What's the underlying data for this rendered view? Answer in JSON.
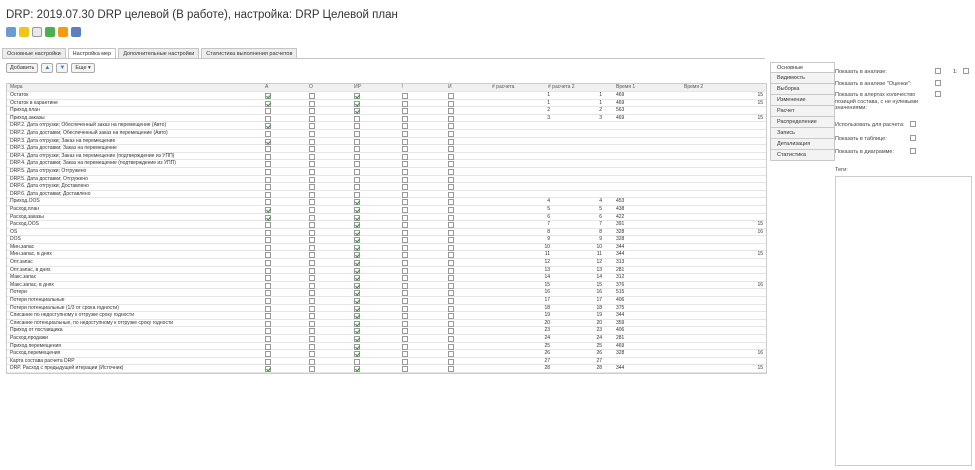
{
  "title": "DRP: 2019.07.30 DRP целевой (В работе), настройка: DRP Целевой план",
  "toolbar": {
    "icons": [
      "view-icon",
      "lock-icon",
      "copy-icon",
      "add-icon",
      "edit-icon",
      "save-icon"
    ]
  },
  "tabs": [
    "Основные настройки",
    "Настройка мер",
    "Дополнительные настройки",
    "Статистика выполнения расчетов"
  ],
  "active_tab": 1,
  "buttons": {
    "add": "Добавить",
    "more": "Еще ▾"
  },
  "columns": {
    "measure": "Мера",
    "a": "А",
    "o": "О",
    "ir": "ИР",
    "excl": "!",
    "i": "И",
    "calc": "# расчета",
    "calc2": "# расчета 2",
    "time1": "Время 1",
    "time2": "Время 2"
  },
  "rows": [
    {
      "name": "Остаток",
      "a": true,
      "o": false,
      "ir": true,
      "ex": false,
      "i": false,
      "calc": "1",
      "calc2": "1",
      "t1": "469",
      "t2": "15"
    },
    {
      "name": "Остаток в карантине",
      "a": true,
      "o": false,
      "ir": true,
      "ex": false,
      "i": false,
      "calc": "1",
      "calc2": "1",
      "t1": "469",
      "t2": "15"
    },
    {
      "name": "Приход.план",
      "a": false,
      "o": false,
      "ir": true,
      "ex": false,
      "i": false,
      "calc": "2",
      "calc2": "2",
      "t1": "563",
      "t2": ""
    },
    {
      "name": "Приход.заказы",
      "a": false,
      "o": false,
      "ir": false,
      "ex": false,
      "i": false,
      "calc": "3",
      "calc2": "3",
      "t1": "469",
      "t2": "15"
    },
    {
      "name": "DRP.2. Дата отгрузки; Обеспеченный заказ на перемещение (Авто)",
      "a": true,
      "o": false,
      "ir": false,
      "ex": false,
      "i": false,
      "calc": "",
      "calc2": "",
      "t1": "",
      "t2": ""
    },
    {
      "name": "DRP.2. Дата доставки; Обеспеченный заказ на перемещение (Авто)",
      "a": false,
      "o": false,
      "ir": false,
      "ex": false,
      "i": false,
      "calc": "",
      "calc2": "",
      "t1": "",
      "t2": ""
    },
    {
      "name": "DRP.3. Дата отгрузки; Заказ на перемещение",
      "a": true,
      "o": false,
      "ir": false,
      "ex": false,
      "i": false,
      "calc": "",
      "calc2": "",
      "t1": "",
      "t2": ""
    },
    {
      "name": "DRP.3. Дата доставки; Заказ на перемещение",
      "a": false,
      "o": false,
      "ir": false,
      "ex": false,
      "i": false,
      "calc": "",
      "calc2": "",
      "t1": "",
      "t2": ""
    },
    {
      "name": "DRP.4. Дата отгрузки; Заказ на перемещение (подтверждение из УПП)",
      "a": false,
      "o": false,
      "ir": false,
      "ex": false,
      "i": false,
      "calc": "",
      "calc2": "",
      "t1": "",
      "t2": ""
    },
    {
      "name": "DRP.4. Дата доставки; Заказ на перемещение (подтверждение из УПП)",
      "a": false,
      "o": false,
      "ir": false,
      "ex": false,
      "i": false,
      "calc": "",
      "calc2": "",
      "t1": "",
      "t2": ""
    },
    {
      "name": "DRP.5. Дата отгрузки; Отгружено",
      "a": false,
      "o": false,
      "ir": false,
      "ex": false,
      "i": false,
      "calc": "",
      "calc2": "",
      "t1": "",
      "t2": ""
    },
    {
      "name": "DRP.5. Дата доставки; Отгружено",
      "a": false,
      "o": false,
      "ir": false,
      "ex": false,
      "i": false,
      "calc": "",
      "calc2": "",
      "t1": "",
      "t2": ""
    },
    {
      "name": "DRP.6. Дата отгрузки; Доставлено",
      "a": false,
      "o": false,
      "ir": false,
      "ex": false,
      "i": false,
      "calc": "",
      "calc2": "",
      "t1": "",
      "t2": ""
    },
    {
      "name": "DRP.6. Дата доставки; Доставлено",
      "a": false,
      "o": false,
      "ir": false,
      "ex": false,
      "i": false,
      "calc": "",
      "calc2": "",
      "t1": "",
      "t2": ""
    },
    {
      "name": "Приход.OOS",
      "a": false,
      "o": false,
      "ir": true,
      "ex": false,
      "i": false,
      "calc": "4",
      "calc2": "4",
      "t1": "453",
      "t2": ""
    },
    {
      "name": "Расход.план",
      "a": true,
      "o": false,
      "ir": true,
      "ex": false,
      "i": false,
      "calc": "5",
      "calc2": "5",
      "t1": "438",
      "t2": ""
    },
    {
      "name": "Расход.заказы",
      "a": true,
      "o": false,
      "ir": true,
      "ex": false,
      "i": false,
      "calc": "6",
      "calc2": "6",
      "t1": "422",
      "t2": ""
    },
    {
      "name": "Расход.OOS",
      "a": false,
      "o": false,
      "ir": true,
      "ex": false,
      "i": false,
      "calc": "7",
      "calc2": "7",
      "t1": "391",
      "t2": "15"
    },
    {
      "name": "OS",
      "a": false,
      "o": false,
      "ir": true,
      "ex": false,
      "i": false,
      "calc": "8",
      "calc2": "8",
      "t1": "328",
      "t2": "16"
    },
    {
      "name": "DOS",
      "a": false,
      "o": false,
      "ir": true,
      "ex": false,
      "i": false,
      "calc": "9",
      "calc2": "9",
      "t1": "328",
      "t2": ""
    },
    {
      "name": "Мин.запас",
      "a": false,
      "o": false,
      "ir": true,
      "ex": false,
      "i": false,
      "calc": "10",
      "calc2": "10",
      "t1": "344",
      "t2": ""
    },
    {
      "name": "Мин.запас, в днях",
      "a": false,
      "o": false,
      "ir": true,
      "ex": false,
      "i": false,
      "calc": "11",
      "calc2": "11",
      "t1": "344",
      "t2": "15"
    },
    {
      "name": "Опт.запас",
      "a": false,
      "o": false,
      "ir": true,
      "ex": false,
      "i": false,
      "calc": "12",
      "calc2": "12",
      "t1": "313",
      "t2": ""
    },
    {
      "name": "Опт.запас, в днях",
      "a": false,
      "o": false,
      "ir": true,
      "ex": false,
      "i": false,
      "calc": "13",
      "calc2": "13",
      "t1": "281",
      "t2": ""
    },
    {
      "name": "Макс.запас",
      "a": false,
      "o": false,
      "ir": true,
      "ex": false,
      "i": false,
      "calc": "14",
      "calc2": "14",
      "t1": "312",
      "t2": ""
    },
    {
      "name": "Макс.запас, в днях",
      "a": false,
      "o": false,
      "ir": true,
      "ex": false,
      "i": false,
      "calc": "15",
      "calc2": "15",
      "t1": "376",
      "t2": "16"
    },
    {
      "name": "Потери",
      "a": false,
      "o": false,
      "ir": true,
      "ex": false,
      "i": false,
      "calc": "16",
      "calc2": "16",
      "t1": "515",
      "t2": ""
    },
    {
      "name": "Потери потенциальные",
      "a": false,
      "o": false,
      "ir": true,
      "ex": false,
      "i": false,
      "calc": "17",
      "calc2": "17",
      "t1": "406",
      "t2": ""
    },
    {
      "name": "Потери потенциальные (1/3 от срока годности)",
      "a": false,
      "o": false,
      "ir": true,
      "ex": false,
      "i": false,
      "calc": "18",
      "calc2": "18",
      "t1": "375",
      "t2": ""
    },
    {
      "name": "Списание по недоступному к отгрузке сроку годности",
      "a": false,
      "o": false,
      "ir": true,
      "ex": false,
      "i": false,
      "calc": "19",
      "calc2": "19",
      "t1": "344",
      "t2": ""
    },
    {
      "name": "Списание потенциальные, по недоступному к отгрузке сроку годности",
      "a": false,
      "o": false,
      "ir": true,
      "ex": false,
      "i": false,
      "calc": "20",
      "calc2": "20",
      "t1": "359",
      "t2": ""
    },
    {
      "name": "Приход от поставщика",
      "a": false,
      "o": false,
      "ir": true,
      "ex": false,
      "i": false,
      "calc": "23",
      "calc2": "23",
      "t1": "406",
      "t2": ""
    },
    {
      "name": "Расход.продажи",
      "a": false,
      "o": false,
      "ir": true,
      "ex": false,
      "i": false,
      "calc": "24",
      "calc2": "24",
      "t1": "281",
      "t2": ""
    },
    {
      "name": "Приход.перемещения",
      "a": false,
      "o": false,
      "ir": true,
      "ex": false,
      "i": false,
      "calc": "25",
      "calc2": "25",
      "t1": "469",
      "t2": ""
    },
    {
      "name": "Расход.перемещения",
      "a": false,
      "o": false,
      "ir": true,
      "ex": false,
      "i": false,
      "calc": "26",
      "calc2": "26",
      "t1": "328",
      "t2": "16"
    },
    {
      "name": "Карта состава расчета DRP",
      "a": false,
      "o": false,
      "ir": false,
      "ex": false,
      "i": false,
      "calc": "27",
      "calc2": "27",
      "t1": "",
      "t2": ""
    },
    {
      "name": "DRP. Расход с предыдущей итерации (Источник)",
      "a": true,
      "o": false,
      "ir": true,
      "ex": false,
      "i": false,
      "calc": "28",
      "calc2": "28",
      "t1": "344",
      "t2": "15"
    }
  ],
  "side_menu": [
    "Основные",
    "Видимость",
    "Выборка",
    "Изменение",
    "Расчет",
    "Распределение",
    "Запись",
    "Детализация",
    "Статистика"
  ],
  "props": {
    "show_in_analysis": "Показать в анализе:",
    "show_in_analysis_value": "1:",
    "show_in_analysis_marks": "Показать в анализе \"Оценки\":",
    "show_in_alerts": "Показать в алертах количество позиций состава, с не нулевыми значениями:",
    "use_for_calc": "Использовать для расчета:",
    "show_in_table": "Показать в таблице:",
    "show_in_chart": "Показать в диаграмме:",
    "tags": "Теги:"
  }
}
